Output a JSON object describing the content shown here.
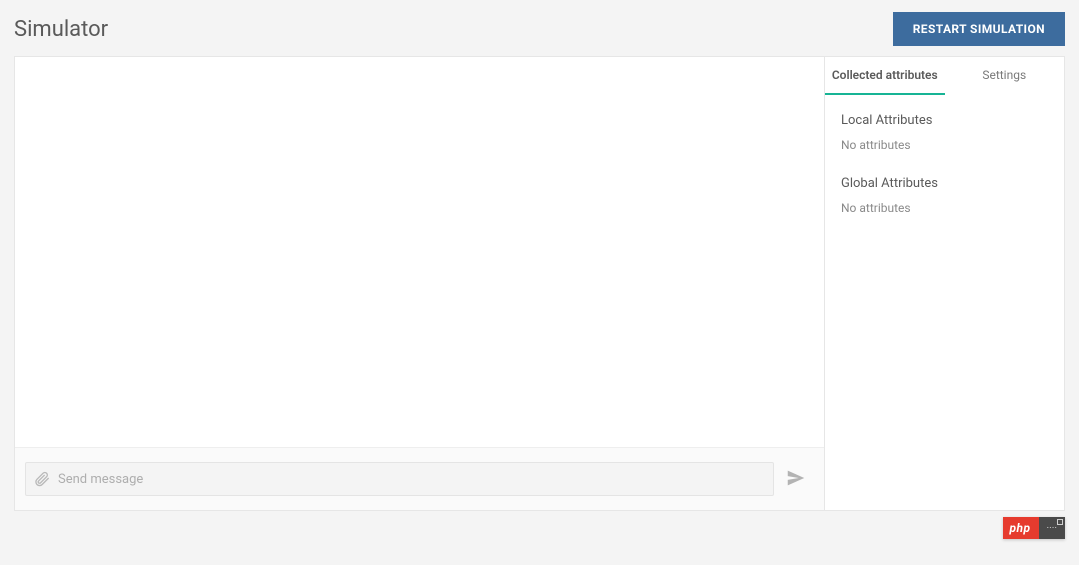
{
  "header": {
    "title": "Simulator",
    "restart_label": "RESTART SIMULATION"
  },
  "chat": {
    "input_placeholder": "Send message"
  },
  "side_panel": {
    "tabs": {
      "collected": "Collected attributes",
      "settings": "Settings"
    },
    "sections": {
      "local_heading": "Local Attributes",
      "local_empty": "No attributes",
      "global_heading": "Global Attributes",
      "global_empty": "No attributes"
    }
  },
  "footer_badge": {
    "left": "php",
    "right": "····"
  },
  "colors": {
    "accent": "#17b495",
    "primary_button": "#3d6c9e",
    "badge_red": "#e63b2e"
  }
}
